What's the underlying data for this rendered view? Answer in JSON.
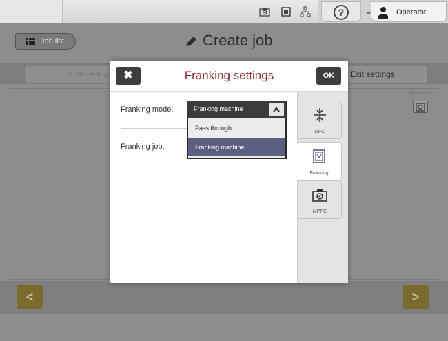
{
  "topbar": {
    "user": "Operator",
    "icons": [
      "camera-icon",
      "franking-icon",
      "network-icon",
      "help-icon",
      "chevron-down-icon",
      "person-icon"
    ]
  },
  "header": {
    "job_list_label": "Job list",
    "title": "Create job"
  },
  "tabs": {
    "mail_settings": "1. Mail settings",
    "exit_settings": "Exit settings"
  },
  "advanced": {
    "label": "Advanced"
  },
  "modal": {
    "title": "Franking settings",
    "ok_label": "OK",
    "close_symbol": "✖",
    "fields": {
      "mode_label": "Franking mode:",
      "mode_value": "Franking machine",
      "job_label": "Franking job:"
    },
    "mode_options": [
      "Pass through",
      "Franking machine"
    ],
    "selected_option_index": 1,
    "side_tabs": [
      {
        "label": "DFC",
        "icon": "dfc-icon"
      },
      {
        "label": "Franking",
        "icon": "franking-icon",
        "active": true
      },
      {
        "label": "MPPC",
        "icon": "camera-icon"
      }
    ]
  },
  "nav": {
    "prev_symbol": "<",
    "next_symbol": ">"
  },
  "colors": {
    "modal_title": "#8a2a2a",
    "selected_option": "#5c5e82",
    "nav_arrow": "#7a6a2e"
  }
}
